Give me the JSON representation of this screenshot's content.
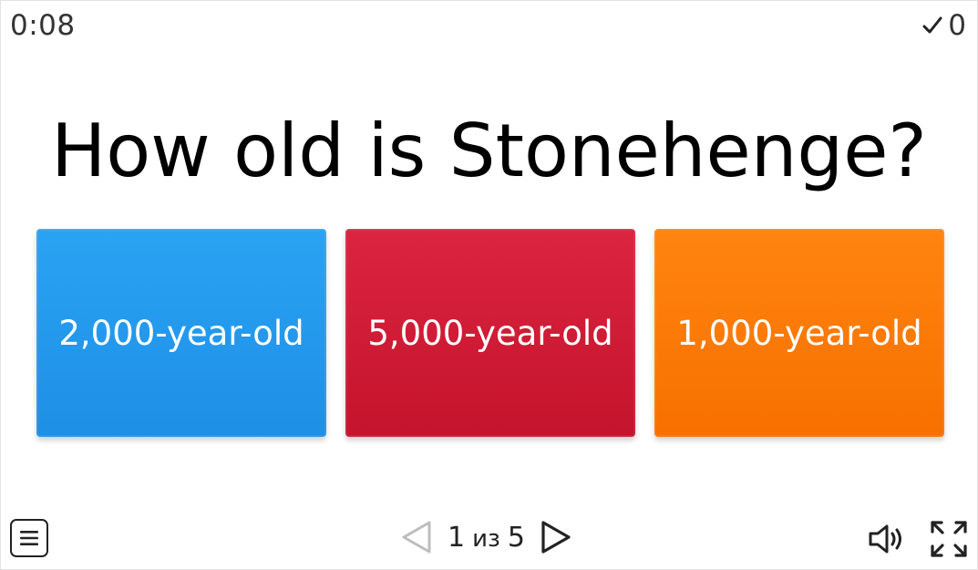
{
  "header": {
    "timer": "0:08",
    "score": "0",
    "score_icon": "check-icon"
  },
  "question": {
    "text": "How old is Stonehenge?"
  },
  "answers": [
    {
      "label": "2,000-year-old",
      "color": "#239cef"
    },
    {
      "label": "5,000-year-old",
      "color": "#d11d36"
    },
    {
      "label": "1,000-year-old",
      "color": "#fb7a08"
    }
  ],
  "footer": {
    "menu_icon": "menu-icon",
    "prev_icon": "triangle-left-icon",
    "next_icon": "triangle-right-icon",
    "current_page": "1",
    "of_label": "из",
    "total_pages": "5",
    "sound_icon": "speaker-icon",
    "fullscreen_icon": "fullscreen-icon"
  }
}
